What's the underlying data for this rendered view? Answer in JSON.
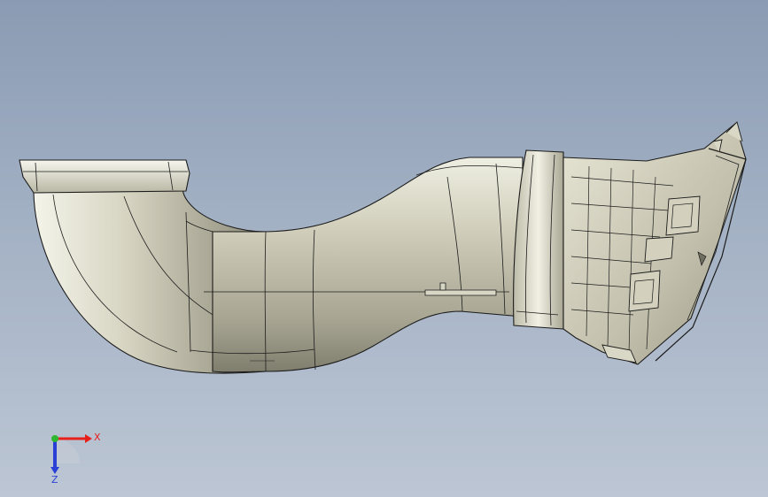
{
  "triad": {
    "x_label": "X",
    "z_label": "Z",
    "colors": {
      "x_axis": "#e8201c",
      "y_axis": "#2fb82f",
      "z_axis": "#2a3fd6"
    }
  },
  "viewport": {
    "background_top": "#8a9bb3",
    "background_bottom": "#bcc6d4",
    "model_color": "#c9c7b4",
    "edge_color": "#1c1c1c"
  }
}
